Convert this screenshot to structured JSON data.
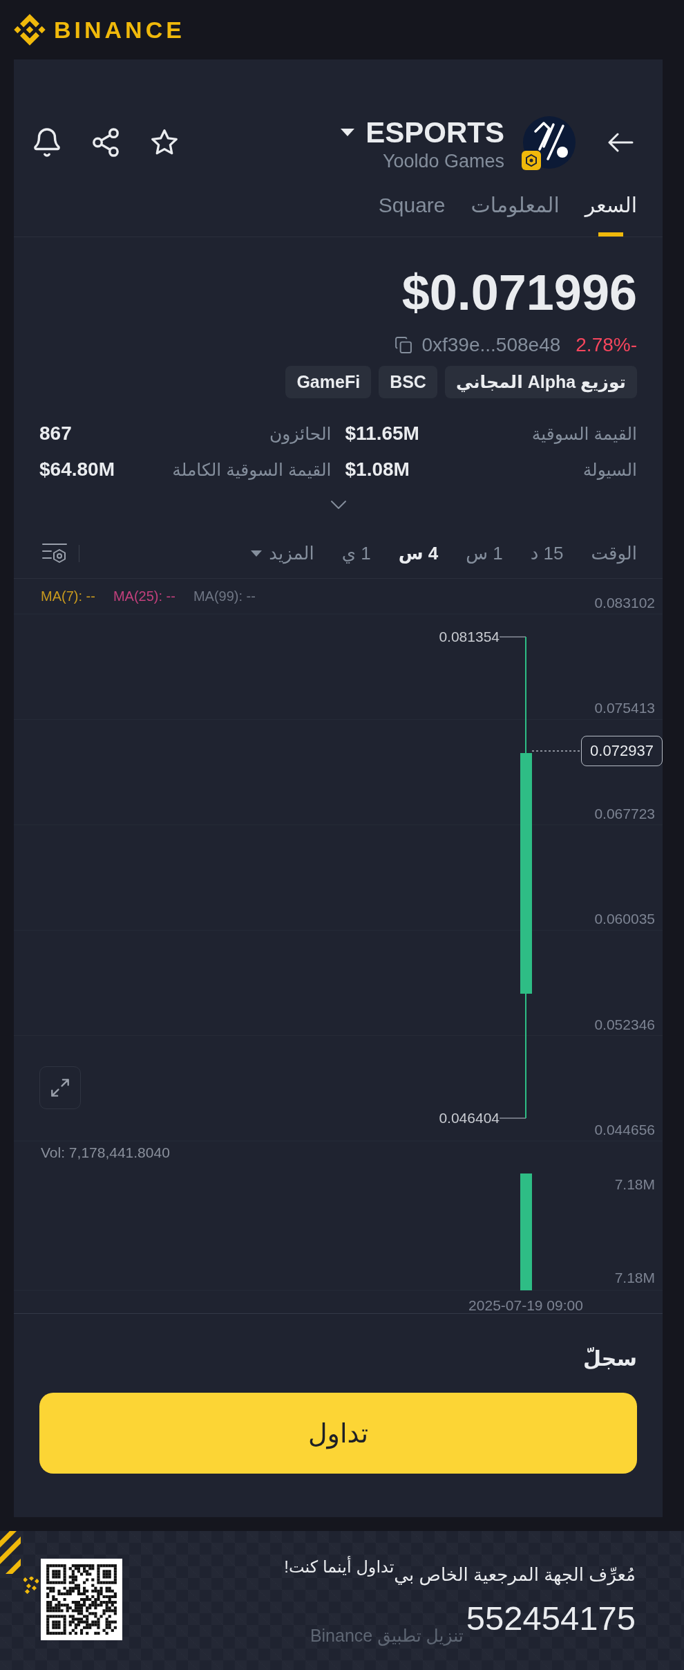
{
  "brand": {
    "name": "BINANCE"
  },
  "header": {
    "symbol": "ESPORTS",
    "project": "Yooldo Games"
  },
  "tabs": [
    {
      "label": "السعر",
      "selected": true
    },
    {
      "label": "المعلومات",
      "selected": false
    },
    {
      "label": "Square",
      "selected": false
    }
  ],
  "price": {
    "value": "$0.071996",
    "contract": "0xf39e...508e48",
    "change": "2.78%-",
    "negative": true
  },
  "tags": [
    {
      "label": "توزيع Alpha المجاني"
    },
    {
      "label": "BSC"
    },
    {
      "label": "GameFi"
    }
  ],
  "stats": [
    {
      "label": "القيمة السوقية",
      "value": "$11.65M"
    },
    {
      "label": "الحائزون",
      "value": "867"
    },
    {
      "label": "السيولة",
      "value": "$1.08M"
    },
    {
      "label": "القيمة السوقية الكاملة",
      "value": "$64.80M"
    }
  ],
  "stats_expanded": false,
  "timeframes": {
    "label": "الوقت",
    "options": [
      {
        "label": "15 د",
        "selected": false
      },
      {
        "label": "1 س",
        "selected": false
      },
      {
        "label": "4 س",
        "selected": true
      },
      {
        "label": "1 ي",
        "selected": false
      }
    ],
    "more": "المزيد"
  },
  "chart": {
    "ma_legend": [
      {
        "label": "MA(99): --",
        "color": "#6f7684"
      },
      {
        "label": "MA(25): --",
        "color": "#c2407c"
      },
      {
        "label": "MA(7): --",
        "color": "#c99a1e"
      }
    ],
    "price_axis": [
      "0.083102",
      "0.075413",
      "0.067723",
      "0.060035",
      "0.052346",
      "0.044656"
    ],
    "high": "0.081354",
    "low": "0.046404",
    "last_price": "0.072937",
    "volume": "Vol: 7,178,441.8040",
    "volume_axis": [
      "7.18M",
      "7.18M"
    ],
    "time": "2025-07-19 09:00"
  },
  "history": {
    "title": "سجلّ"
  },
  "trade_button": {
    "label": "تداول"
  },
  "footer": {
    "referral_label": "مُعرِّف الجهة المرجعية الخاص بي",
    "slogan": "تداول أينما كنت!",
    "referral_id": "552454175",
    "download": "تنزيل تطبيق Binance"
  }
}
